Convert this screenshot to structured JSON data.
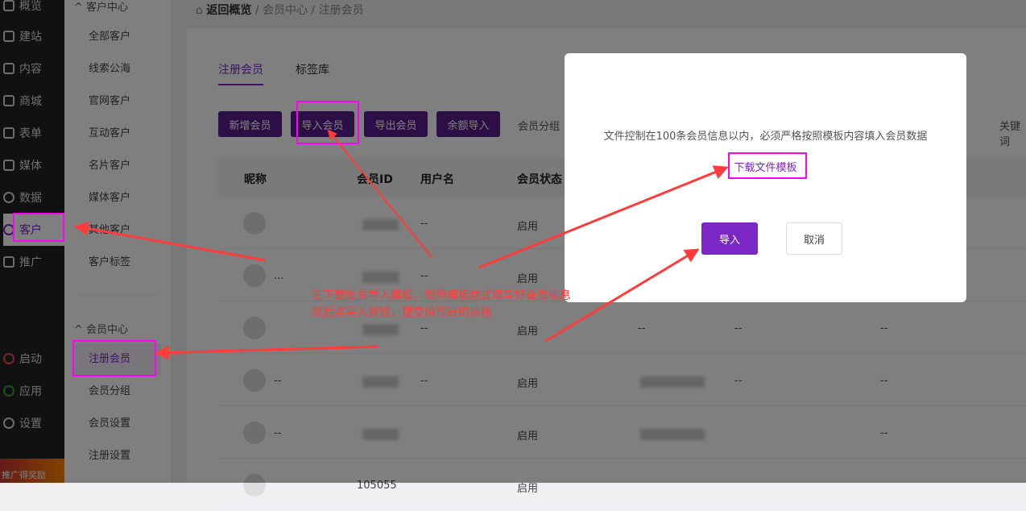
{
  "sidebar": {
    "items": [
      "概览",
      "建站",
      "内容",
      "商城",
      "表单",
      "媒体",
      "数据",
      "客户",
      "推广",
      "启动",
      "应用",
      "设置"
    ],
    "promo": "推广得奖励"
  },
  "subnav": {
    "group1": "客户中心",
    "group1_items": [
      "全部客户",
      "线索公海",
      "官网客户",
      "互动客户",
      "名片客户",
      "媒体客户",
      "其他客户",
      "客户标签"
    ],
    "group2": "会员中心",
    "group2_items": [
      "注册会员",
      "会员分组",
      "会员设置",
      "注册设置"
    ]
  },
  "breadcrumb": {
    "back": "返回概览",
    "sep": "/",
    "mid": "会员中心",
    "current": "注册会员"
  },
  "tabs": [
    "注册会员",
    "标签库"
  ],
  "toolbar": {
    "buttons": [
      "新增会员",
      "导入会员",
      "导出会员",
      "余额导入"
    ],
    "group_label": "会员分组",
    "keyword_label": "关键词"
  },
  "table": {
    "headers": [
      "昵称",
      "会员ID",
      "用户名",
      "会员状态"
    ],
    "rows": [
      {
        "name": "",
        "username": "--",
        "status": "启用"
      },
      {
        "name": "...",
        "username": "--",
        "status": "启用"
      },
      {
        "name": "",
        "username": "--",
        "status": "启用"
      },
      {
        "name": "--",
        "username": "--",
        "status": "启用"
      },
      {
        "name": "--",
        "username": "",
        "status": "启用"
      },
      {
        "name": "",
        "id": "105055",
        "username": "",
        "status": "启用"
      }
    ],
    "extra_dash": "--"
  },
  "modal": {
    "text": "文件控制在100条会员信息以内，必须严格按照模板内容填入会员数据",
    "link": "下载文件模板",
    "ok": "导入",
    "cancel": "取消"
  },
  "annotation": {
    "line1": "先下载批量导入模板，按照模板格式填写好会员信息",
    "line2": "然后点导入按钮，提交填写好的表格",
    "color": "#ff3b3b",
    "box_color": "#ff00ff"
  }
}
